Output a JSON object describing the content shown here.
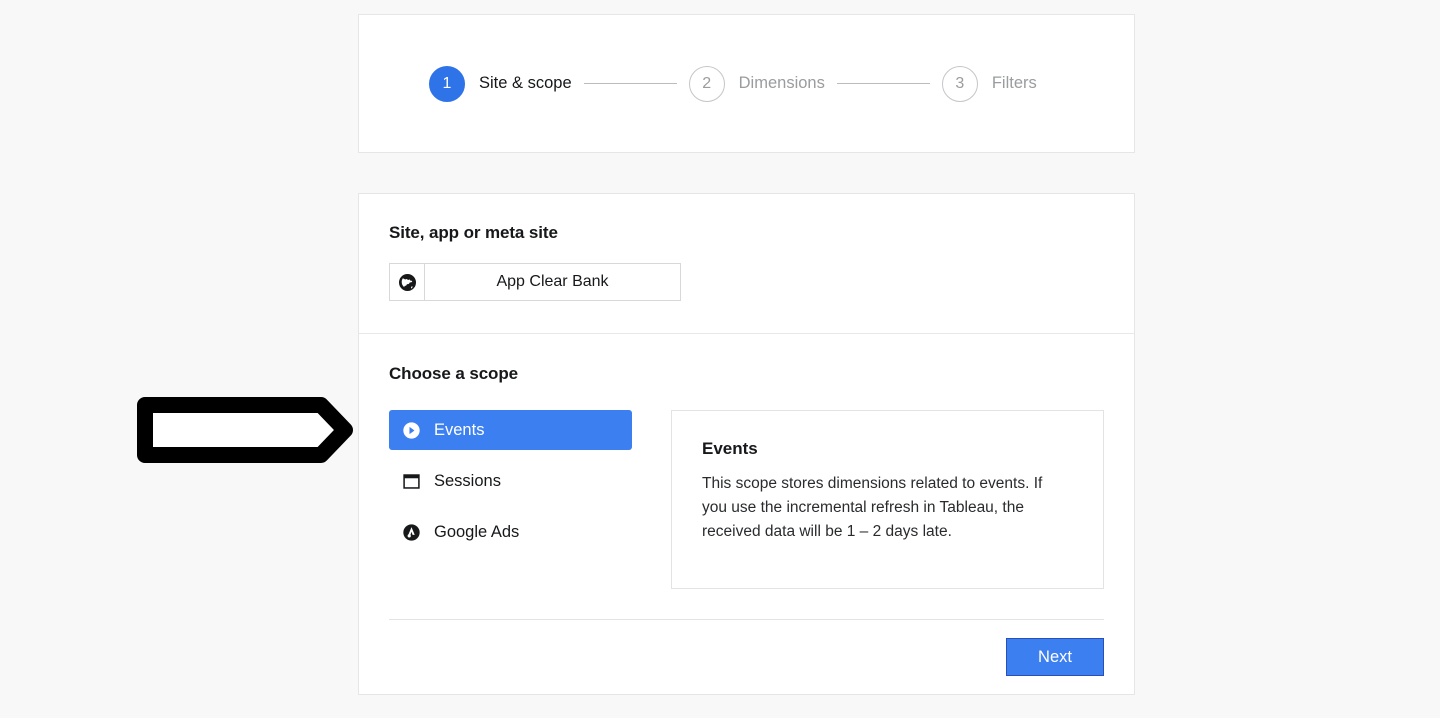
{
  "stepper": {
    "steps": [
      {
        "number": "1",
        "label": "Site & scope",
        "state": "active"
      },
      {
        "number": "2",
        "label": "Dimensions",
        "state": "inactive"
      },
      {
        "number": "3",
        "label": "Filters",
        "state": "inactive"
      }
    ]
  },
  "site_section": {
    "title": "Site, app or meta site",
    "icon": "globe-icon",
    "value": "App Clear Bank"
  },
  "scope_section": {
    "title": "Choose a scope",
    "options": [
      {
        "label": "Events",
        "icon": "play-circle-icon",
        "selected": true
      },
      {
        "label": "Sessions",
        "icon": "window-icon",
        "selected": false
      },
      {
        "label": "Google Ads",
        "icon": "google-ads-icon",
        "selected": false
      }
    ],
    "info": {
      "title": "Events",
      "text": "This scope stores dimensions related to events. If you use the incremental refresh in Tableau, the received data will be 1 – 2 days late."
    }
  },
  "footer": {
    "next_label": "Next"
  },
  "annotation": {
    "shape": "right-arrow-outline"
  },
  "colors": {
    "accent_blue": "#3b7ff0",
    "step_active_blue": "#2f73e8",
    "next_border": "#2a50b8",
    "page_background": "#f8f8f8",
    "muted_text": "#9a9c9e"
  }
}
